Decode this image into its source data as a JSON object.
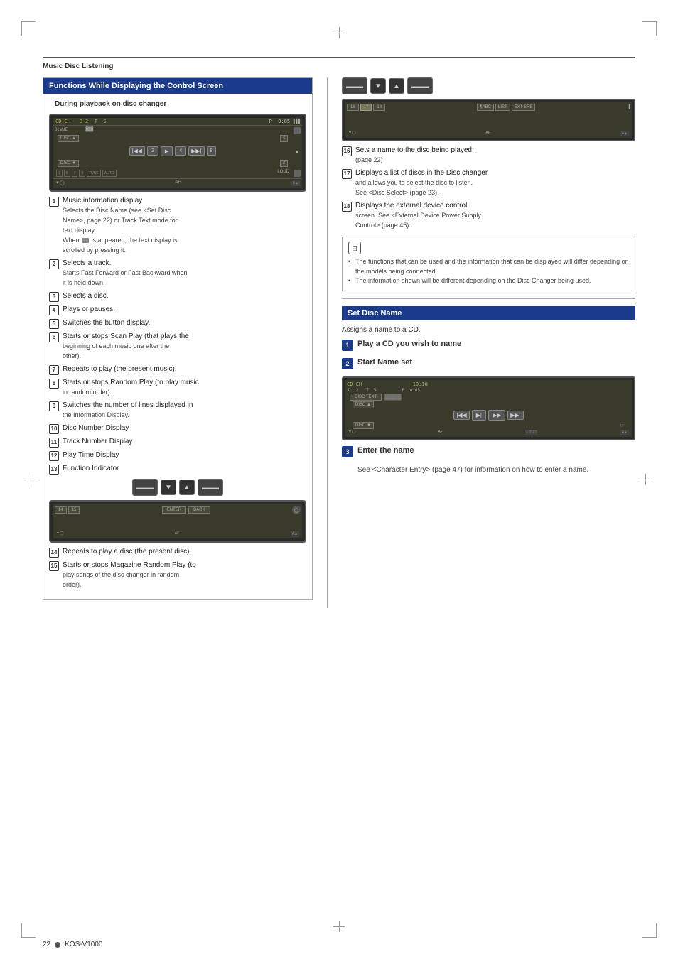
{
  "page": {
    "section_header": "Music Disc Listening",
    "left_column": {
      "box_title": "Functions While Displaying the Control Screen",
      "sub_title": "During playback on disc changer",
      "items": [
        {
          "num": "1",
          "title": "Music information display",
          "lines": [
            "Selects the Disc Name (see <Set Disc",
            "Name>, page 22) or Track Text mode for",
            "text display.",
            "When        is appeared, the text display is",
            "scrolled by pressing it."
          ]
        },
        {
          "num": "2",
          "title": "Selects a track.",
          "lines": [
            "Starts Fast Forward or Fast Backward when",
            "it is held down."
          ]
        },
        {
          "num": "3",
          "title": "Selects a disc.",
          "lines": []
        },
        {
          "num": "4",
          "title": "Plays or pauses.",
          "lines": []
        },
        {
          "num": "5",
          "title": "Switches the button display.",
          "lines": []
        },
        {
          "num": "6",
          "title": "Starts or stops Scan Play (that plays the",
          "lines": [
            "beginning of each music one after the",
            "other)."
          ]
        },
        {
          "num": "7",
          "title": "Repeats to play (the present music).",
          "lines": []
        },
        {
          "num": "8",
          "title": "Starts or stops Random Play (to play music",
          "lines": [
            "in random order)."
          ]
        },
        {
          "num": "9",
          "title": "Switches the number of lines displayed in",
          "lines": [
            "the Information Display."
          ]
        },
        {
          "num": "10",
          "title": "Disc Number Display",
          "lines": []
        },
        {
          "num": "11",
          "title": "Track Number Display",
          "lines": []
        },
        {
          "num": "12",
          "title": "Play Time Display",
          "lines": []
        },
        {
          "num": "13",
          "title": "Function Indicator",
          "lines": []
        }
      ],
      "items2": [
        {
          "num": "14",
          "title": "Repeats to play a disc (the present disc).",
          "lines": []
        },
        {
          "num": "15",
          "title": "Starts or stops Magazine Random Play (to",
          "lines": [
            "play songs of the disc changer in random",
            "order)."
          ]
        }
      ]
    },
    "right_column": {
      "items": [
        {
          "num": "16",
          "title": "Sets a name to the disc being played.",
          "lines": [
            "(page 22)"
          ]
        },
        {
          "num": "17",
          "title": "Displays a list of discs in the Disc changer",
          "lines": [
            "and allows you to select the disc to listen.",
            "See <Disc Select> (page 23)."
          ]
        },
        {
          "num": "18",
          "title": "Displays the external device control",
          "lines": [
            "screen. See <External Device Power Supply",
            "Control> (page 45)."
          ]
        }
      ],
      "note_bullets": [
        "The functions that can be used and the information that can be displayed will differ depending on the models being connected.",
        "The information shown will be different depending on the Disc Changer being used."
      ],
      "set_disc_name": {
        "title": "Set Disc Name",
        "sub": "Assigns a name to a CD.",
        "step1_label": "1",
        "step1_text": "Play a CD you wish to name",
        "step2_label": "2",
        "step2_text": "Start Name set",
        "step3_label": "3",
        "step3_text": "Enter the name",
        "step3_desc": "See <Character Entry> (page 47) for information on how to enter a name."
      }
    },
    "footer": {
      "page_num": "22",
      "model": "KOS-V1000"
    }
  }
}
